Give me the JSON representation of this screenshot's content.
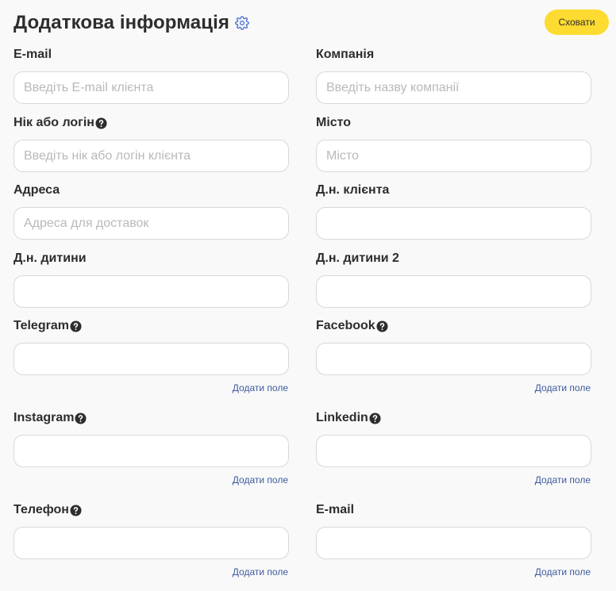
{
  "header": {
    "title": "Додаткова інформація",
    "hide_label": "Сховати"
  },
  "fields": [
    {
      "label": "E-mail",
      "placeholder": "Введіть E-mail клієнта",
      "value": "",
      "help": false,
      "add_link": ""
    },
    {
      "label": "Компанія",
      "placeholder": "Введіть назву компанії",
      "value": "",
      "help": false,
      "add_link": ""
    },
    {
      "label": "Нік або логін",
      "placeholder": "Введіть нік або логін клієнта",
      "value": "",
      "help": true,
      "add_link": ""
    },
    {
      "label": "Місто",
      "placeholder": "Місто",
      "value": "",
      "help": false,
      "add_link": ""
    },
    {
      "label": "Адреса",
      "placeholder": "Адреса для доставок",
      "value": "",
      "help": false,
      "add_link": ""
    },
    {
      "label": "Д.н. клієнта",
      "placeholder": "",
      "value": "",
      "help": false,
      "add_link": ""
    },
    {
      "label": "Д.н. дитини",
      "placeholder": "",
      "value": "",
      "help": false,
      "add_link": ""
    },
    {
      "label": "Д.н. дитини 2",
      "placeholder": "",
      "value": "",
      "help": false,
      "add_link": ""
    },
    {
      "label": "Telegram",
      "placeholder": "",
      "value": "",
      "help": true,
      "add_link": "Додати поле"
    },
    {
      "label": "Facebook",
      "placeholder": "",
      "value": "",
      "help": true,
      "add_link": "Додати поле"
    },
    {
      "label": "Instagram",
      "placeholder": "",
      "value": "",
      "help": true,
      "add_link": "Додати поле"
    },
    {
      "label": "Linkedin",
      "placeholder": "",
      "value": "",
      "help": true,
      "add_link": "Додати поле"
    },
    {
      "label": "Телефон",
      "placeholder": "",
      "value": "",
      "help": true,
      "add_link": "Додати поле"
    },
    {
      "label": "E-mail",
      "placeholder": "",
      "value": "",
      "help": false,
      "add_link": "Додати поле"
    }
  ],
  "icons": {
    "settings": "gear-icon",
    "help": "question-circle-icon"
  },
  "colors": {
    "accent": "#fddb30",
    "link": "#3d5a9e",
    "gear": "#4a6fd6"
  }
}
